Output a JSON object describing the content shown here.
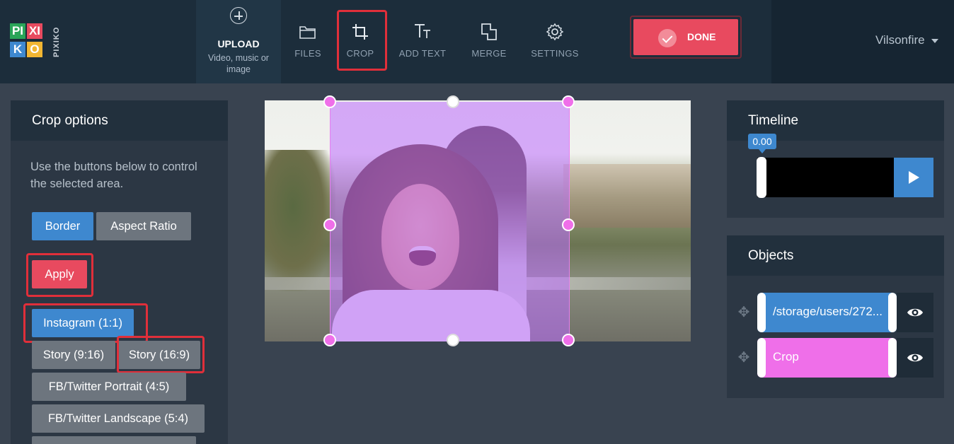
{
  "app": {
    "logo_letters": [
      "PI",
      "XI",
      "K",
      "O"
    ],
    "logo_side": "PIXIKO"
  },
  "toolbar": {
    "upload": {
      "title": "UPLOAD",
      "subtitle": "Video, music or image",
      "icon": "plus-circle-icon"
    },
    "tools": [
      {
        "label": "FILES",
        "icon": "folder-icon"
      },
      {
        "label": "CROP",
        "icon": "crop-icon"
      },
      {
        "label": "ADD TEXT",
        "icon": "text-icon"
      },
      {
        "label": "MERGE",
        "icon": "merge-icon"
      },
      {
        "label": "SETTINGS",
        "icon": "gear-icon"
      }
    ],
    "done_label": "DONE",
    "user_name": "Vilsonfire"
  },
  "crop_panel": {
    "title": "Crop options",
    "help_text": "Use the buttons below to control the selected area.",
    "buttons": {
      "border": "Border",
      "aspect_ratio": "Aspect Ratio",
      "apply": "Apply",
      "instagram": "Instagram (1:1)",
      "story_916": "Story (9:16)",
      "story_169": "Story (16:9)",
      "fb_portrait": "FB/Twitter Portrait (4:5)",
      "fb_landscape": "FB/Twitter Landscape (5:4)"
    }
  },
  "timeline": {
    "title": "Timeline",
    "time": "0.00"
  },
  "objects": {
    "title": "Objects",
    "items": [
      {
        "label": "/storage/users/272...",
        "color": "#3e88cf"
      },
      {
        "label": "Crop",
        "color": "#ef6fe9"
      }
    ]
  },
  "colors": {
    "accent_blue": "#3e88cf",
    "accent_red": "#e84a5f",
    "crop_pink": "#ef6fe9",
    "highlight_red": "#e02f3a"
  }
}
